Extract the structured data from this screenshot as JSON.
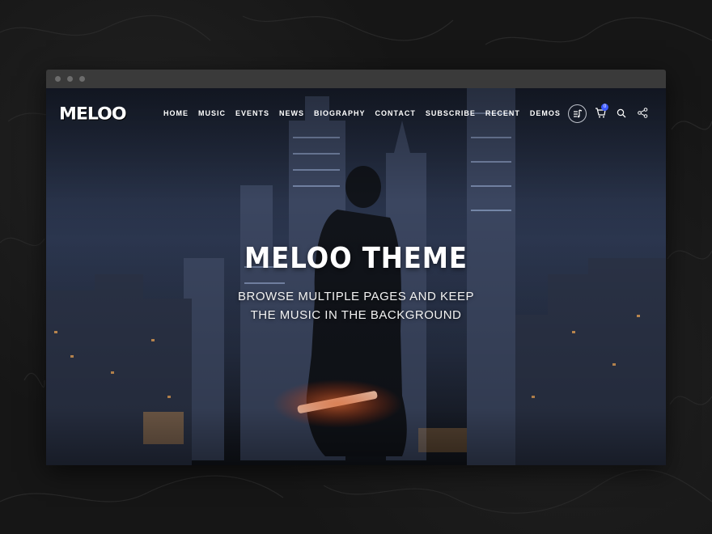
{
  "site": {
    "logo_text": "MELOO"
  },
  "nav": {
    "items": [
      "HOME",
      "MUSIC",
      "EVENTS",
      "NEWS",
      "BIOGRAPHY",
      "CONTACT",
      "SUBSCRIBE",
      "RECENT",
      "DEMOS"
    ]
  },
  "toolbar": {
    "cart_count": "0",
    "icons": [
      "playlist-icon",
      "cart-icon",
      "search-icon",
      "share-icon"
    ]
  },
  "hero": {
    "title": "MELOO THEME",
    "subtitle": "BROWSE MULTIPLE PAGES AND KEEP THE MUSIC IN THE BACKGROUND"
  },
  "colors": {
    "page_background": "#161616",
    "browser_chrome": "#3a3a3a",
    "badge_accent": "#3d5afe",
    "glow_accent": "#ff5a1f"
  }
}
